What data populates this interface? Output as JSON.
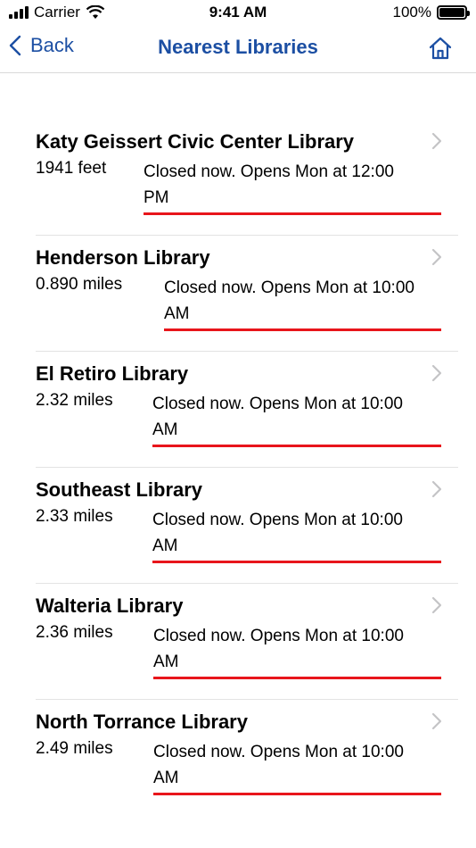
{
  "status_bar": {
    "carrier": "Carrier",
    "time": "9:41 AM",
    "battery": "100%"
  },
  "nav": {
    "back_label": "Back",
    "title": "Nearest Libraries"
  },
  "libraries": [
    {
      "name": "Katy Geissert Civic Center Library",
      "distance": "1941 feet",
      "status_line1": "Closed now. Opens Mon at 12:00",
      "status_line2": "PM"
    },
    {
      "name": "Henderson Library",
      "distance": "0.890 miles",
      "status_line1": "Closed now. Opens Mon at 10:00",
      "status_line2": "AM"
    },
    {
      "name": "El Retiro Library",
      "distance": "2.32 miles",
      "status_line1": "Closed now. Opens Mon at 10:00",
      "status_line2": "AM"
    },
    {
      "name": "Southeast Library",
      "distance": "2.33 miles",
      "status_line1": "Closed now. Opens Mon at 10:00",
      "status_line2": "AM"
    },
    {
      "name": "Walteria Library",
      "distance": "2.36 miles",
      "status_line1": "Closed now. Opens Mon at 10:00",
      "status_line2": "AM"
    },
    {
      "name": "North Torrance Library",
      "distance": "2.49 miles",
      "status_line1": "Closed now. Opens Mon at 10:00",
      "status_line2": "AM"
    }
  ],
  "colors": {
    "accent": "#1c4fa3",
    "status_underline": "#e8151b"
  }
}
